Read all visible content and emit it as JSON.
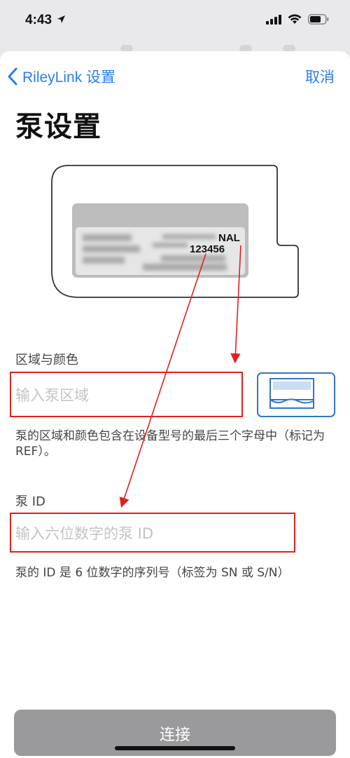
{
  "status_bar": {
    "time": "4:43"
  },
  "nav": {
    "back_label": "RileyLink 设置",
    "cancel_label": "取消"
  },
  "page_title": "泵设置",
  "illustration": {
    "label_code": "NAL",
    "label_serial": "123456"
  },
  "region": {
    "label": "区域与颜色",
    "placeholder": "输入泵区域",
    "help": "泵的区域和颜色包含在设备型号的最后三个字母中（标记为 REF）。"
  },
  "pump_id": {
    "label": "泵 ID",
    "placeholder": "输入六位数字的泵 ID",
    "help": "泵的 ID 是 6 位数字的序列号（标签为 SN 或 S/N）"
  },
  "connect_label": "连接",
  "colors": {
    "accent": "#2a7cf5",
    "highlight": "#e0201e",
    "button": "#9a9a9d"
  }
}
